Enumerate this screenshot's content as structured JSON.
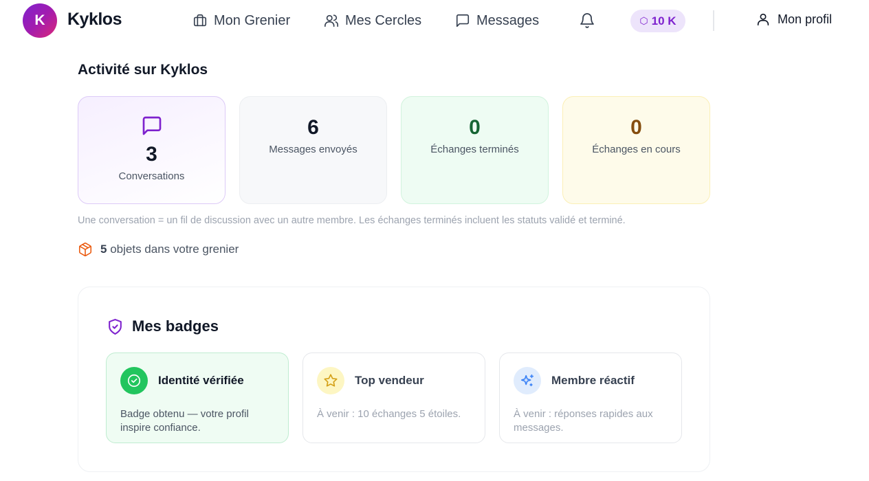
{
  "header": {
    "logo_letter": "K",
    "brand": "Kyklos",
    "nav": [
      {
        "label": "Mon Grenier",
        "icon": "briefcase-icon"
      },
      {
        "label": "Mes Cercles",
        "icon": "users-icon"
      },
      {
        "label": "Messages",
        "icon": "message-square-icon"
      }
    ],
    "points": "10 K",
    "points_icon": "⬡",
    "profile_label": "Mon profil"
  },
  "activity": {
    "title": "Activité sur Kyklos",
    "stats": [
      {
        "value": "3",
        "label": "Conversations"
      },
      {
        "value": "6",
        "label": "Messages envoyés"
      },
      {
        "value": "0",
        "label": "Échanges terminés"
      },
      {
        "value": "0",
        "label": "Échanges en cours"
      }
    ],
    "note": "Une conversation = un fil de discussion avec un autre membre. Les échanges terminés incluent les statuts validé et terminé.",
    "objects_count": "5",
    "objects_text": "objets dans votre grenier"
  },
  "badges": {
    "title": "Mes badges",
    "items": [
      {
        "name": "Identité vérifiée",
        "desc": "Badge obtenu — votre profil inspire confiance.",
        "icon": "check-circle-icon"
      },
      {
        "name": "Top vendeur",
        "desc": "À venir : 10 échanges 5 étoiles.",
        "icon": "star-icon"
      },
      {
        "name": "Membre réactif",
        "desc": "À venir : réponses rapides aux messages.",
        "icon": "sparkles-icon"
      }
    ]
  },
  "colors": {
    "accent": "#7e22ce",
    "success": "#22c55e",
    "warning_text": "#854d0e"
  }
}
